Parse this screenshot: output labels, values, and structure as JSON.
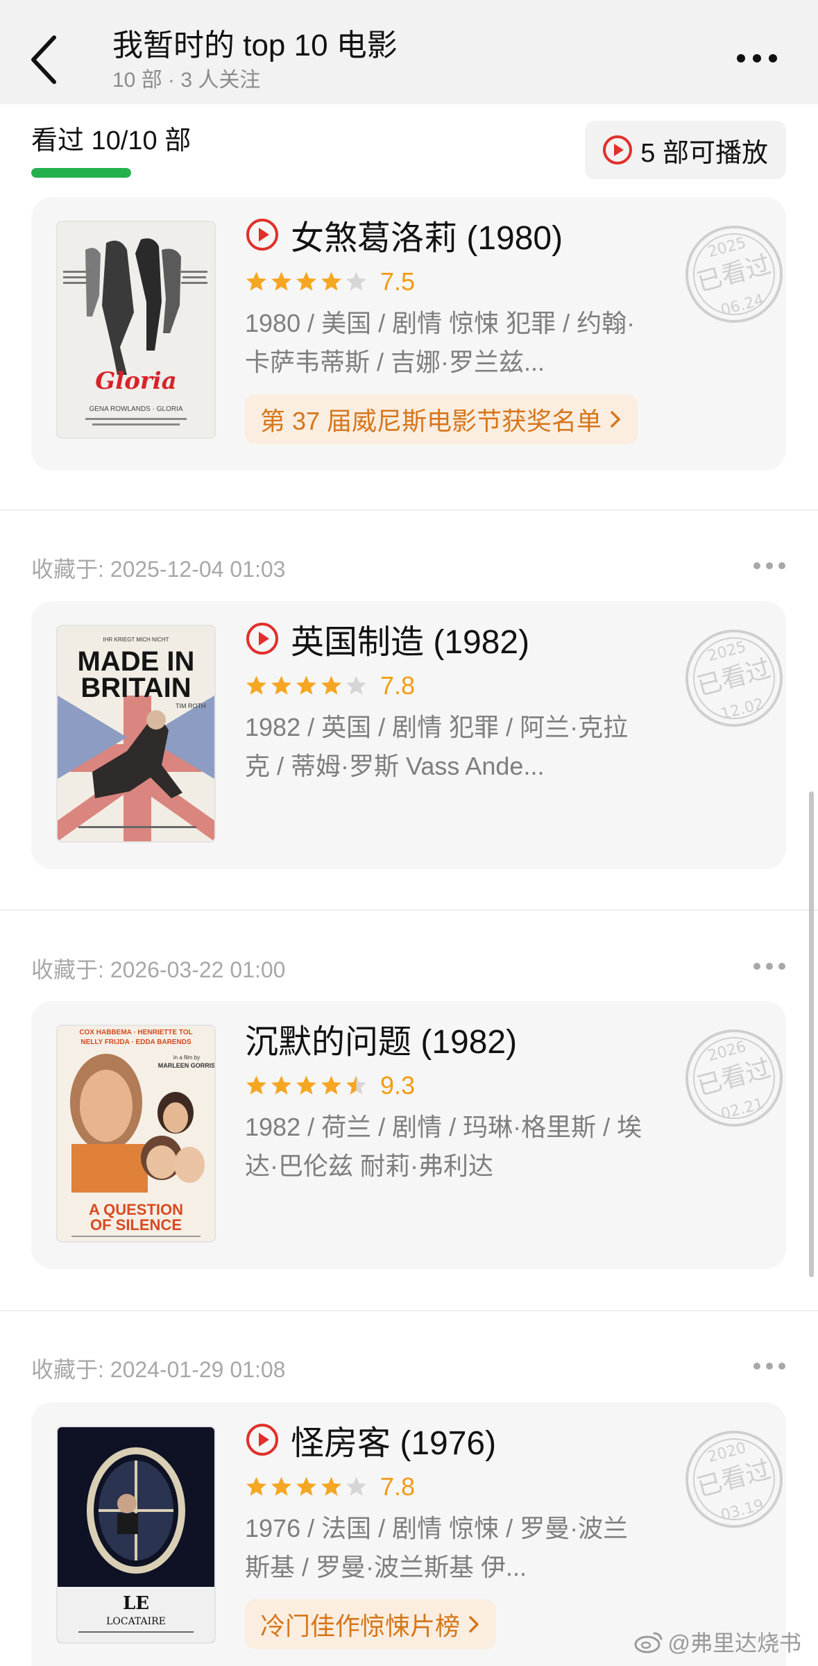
{
  "header": {
    "title": "我暂时的 top 10 电影",
    "subtitle": "10 部 · 3 人关注"
  },
  "status": {
    "watched_label": "看过 10/10 部",
    "watched_fraction": 1.0,
    "playable_label": "5 部可播放",
    "accent_green": "#22b14c",
    "accent_red": "#e0302b"
  },
  "entries": [
    {
      "title": "女煞葛洛莉 (1980)",
      "rating": "7.5",
      "stars": 4,
      "meta": "1980 / 美国 / 剧情 惊悚 犯罪 / 约翰·卡萨韦蒂斯 / 吉娜·罗兰兹...",
      "tag": "第 37 届威尼斯电影节获奖名单",
      "stamp_year": "2025",
      "stamp_label": "已看过",
      "stamp_date": "06.24",
      "poster_title": "Gloria",
      "poster_credit": "GENA ROWLANDS · GLORIA",
      "playable": true
    },
    {
      "saved": "收藏于: 2025-12-04 01:03",
      "title": "英国制造 (1982)",
      "rating": "7.8",
      "stars": 4,
      "meta": "1982 / 英国 / 剧情 犯罪 / 阿兰·克拉克 / 蒂姆·罗斯 Vass Ande...",
      "stamp_year": "2025",
      "stamp_label": "已看过",
      "stamp_date": "12.02",
      "poster_title_1": "MADE IN",
      "poster_title_2": "BRITAIN",
      "poster_credit": "TIM ROTH",
      "playable": true
    },
    {
      "saved": "收藏于: 2026-03-22 01:00",
      "title": "沉默的问题 (1982)",
      "rating": "9.3",
      "stars": 4.5,
      "meta": "1982 / 荷兰 / 剧情 / 玛琳·格里斯 / 埃达·巴伦兹 耐莉·弗利达",
      "stamp_year": "2026",
      "stamp_label": "已看过",
      "stamp_date": "02.21",
      "poster_top": "COX HABBEMA · HENRIETTE TOL",
      "poster_top2": "NELLY FRIJDA · EDDA BARENDS",
      "poster_director": "MARLEEN GORRIS",
      "poster_title_1": "A QUESTION",
      "poster_title_2": "OF SILENCE",
      "playable": false
    },
    {
      "saved": "收藏于: 2024-01-29 01:08",
      "title": "怪房客 (1976)",
      "rating": "7.8",
      "stars": 4,
      "meta": "1976 / 法国 / 剧情 惊悚 / 罗曼·波兰斯基 / 罗曼·波兰斯基 伊...",
      "tag": "冷门佳作惊悚片榜",
      "stamp_year": "2020",
      "stamp_label": "已看过",
      "stamp_date": "03.19",
      "poster_title_1": "LE",
      "poster_title_2": "LOCATAIRE",
      "playable": true
    }
  ],
  "watermark": "@弗里达烧书"
}
